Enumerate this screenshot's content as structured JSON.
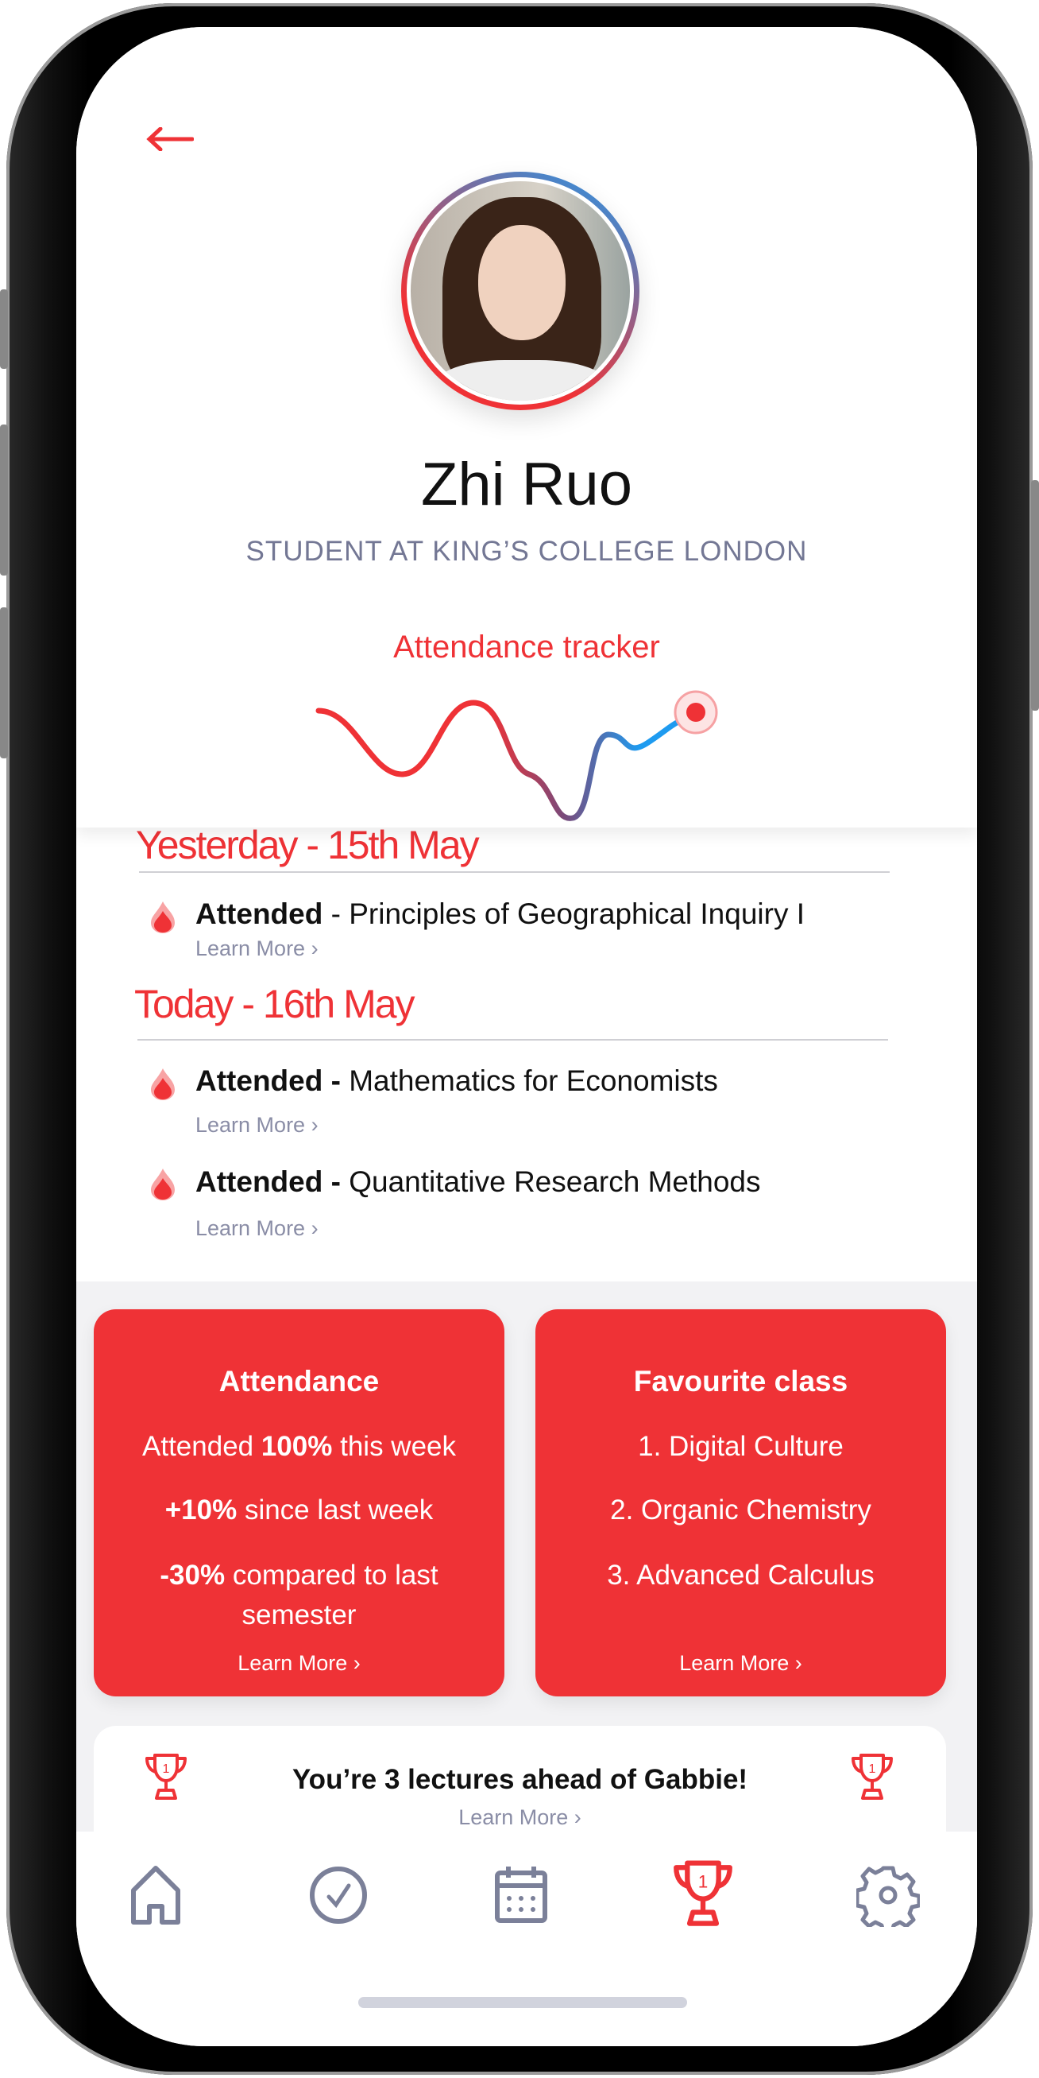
{
  "header": {
    "back_icon": "arrow-left-icon",
    "name": "Zhi Ruo",
    "subtitle": "STUDENT AT KING’S COLLEGE LONDON",
    "tracker_title": "Attendance tracker"
  },
  "colors": {
    "accent": "#ef3236",
    "blue": "#1e9bf0",
    "muted": "#737794"
  },
  "feed": [
    {
      "heading": "Yesterday - 15th May",
      "items": [
        {
          "status": "Attended",
          "sep": " - ",
          "course": "Principles of Geographical Inquiry I",
          "link": "Learn More"
        }
      ]
    },
    {
      "heading": "Today - 16th May",
      "items": [
        {
          "status": "Attended -",
          "sep": " ",
          "course": "Mathematics for Economists",
          "link": "Learn More"
        },
        {
          "status": "Attended -",
          "sep": " ",
          "course": "Quantitative Research Methods",
          "link": "Learn More"
        }
      ]
    }
  ],
  "cards": {
    "attendance": {
      "title": "Attendance",
      "l1_pre": "Attended ",
      "l1_bold": "100%",
      "l1_post": " this week",
      "l2_bold": "+10%",
      "l2_post": " since last week",
      "l3_bold": "-30%",
      "l3_post": " compared to last semester",
      "link": "Learn More"
    },
    "favourite": {
      "title": "Favourite class",
      "items": [
        "1. Digital Culture",
        "2. Organic Chemistry",
        "3. Advanced Calculus"
      ],
      "link": "Learn More"
    }
  },
  "banner": {
    "text": "You’re 3 lectures ahead of Gabbie!",
    "link": "Learn More",
    "icon": "trophy-icon"
  },
  "nav": {
    "items": [
      "home",
      "check",
      "calendar",
      "trophy",
      "settings"
    ],
    "active": "trophy"
  }
}
